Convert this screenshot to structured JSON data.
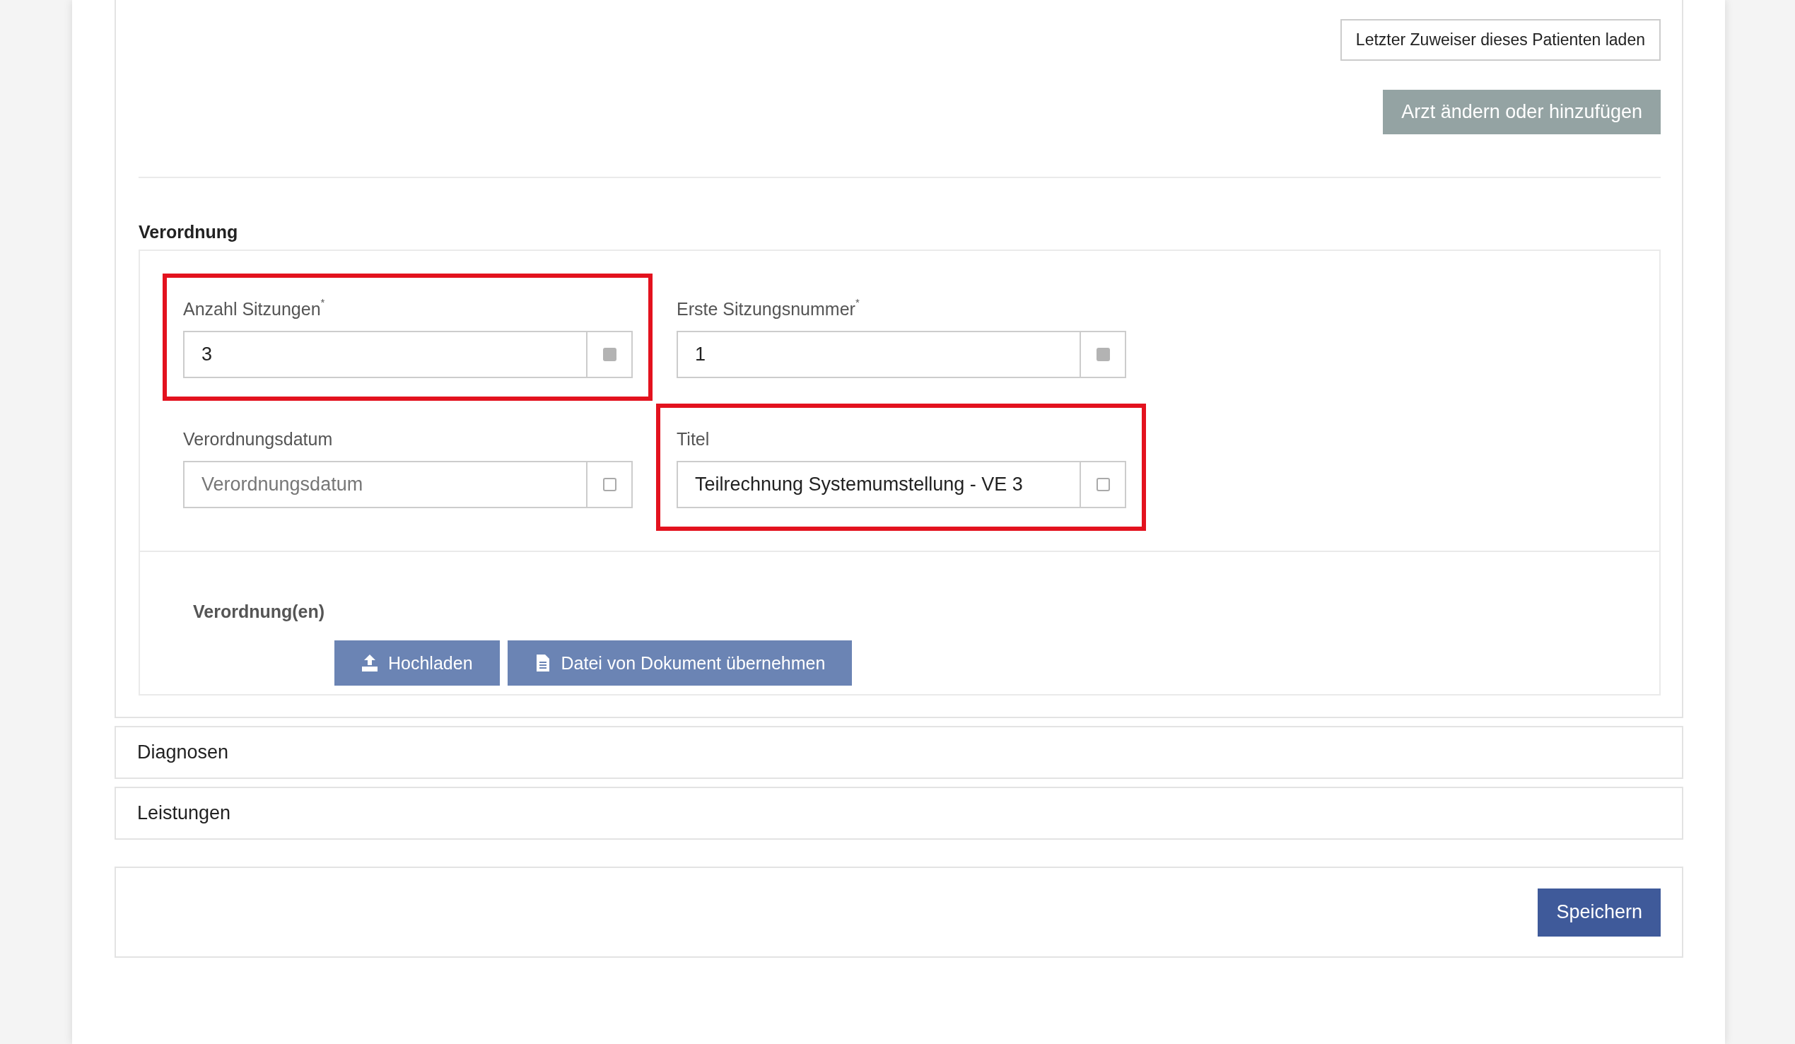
{
  "top_buttons": [
    {
      "label": "Letzter Zuweiser dieses Patienten laden",
      "kind": "outline"
    },
    {
      "label": "Arzt ändern oder hinzufügen",
      "kind": "grey"
    }
  ],
  "section_title": "Verordnung",
  "fields": [
    {
      "label": "Anzahl Sitzungen",
      "required_mark": "*",
      "value": "3",
      "checked": true,
      "highlighted": true
    },
    {
      "label": "Erste Sitzungsnummer",
      "required_mark": "*",
      "value": "1",
      "checked": true,
      "highlighted": false
    },
    {
      "label": "Verordnungsdatum",
      "placeholder": "Verordnungsdatum",
      "checked": false,
      "highlighted": false
    },
    {
      "label": "Titel",
      "value": "Teilrechnung Systemumstellung - VE 3",
      "checked": false,
      "highlighted": true
    }
  ],
  "uploads": {
    "label": "Verordnung(en)",
    "buttons": [
      {
        "label": "Hochladen",
        "kind": "upload"
      },
      {
        "label": "Datei von Dokument übernehmen",
        "kind": "document"
      }
    ]
  },
  "panels": [
    "Diagnosen",
    "Leistungen"
  ],
  "save_button": "Speichern"
}
